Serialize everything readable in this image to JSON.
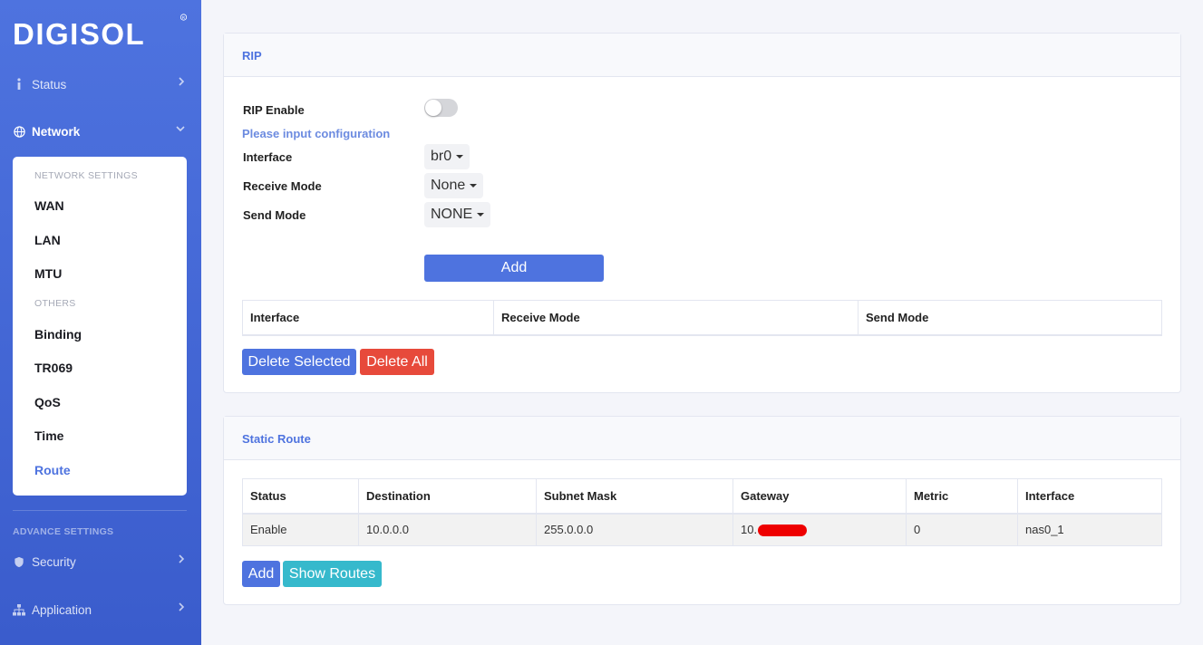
{
  "brand": {
    "logo_text": "DIGISOL"
  },
  "sidebar": {
    "status_label": "Status",
    "network_label": "Network",
    "network_settings_heading": "NETWORK SETTINGS",
    "network_items": [
      "WAN",
      "LAN",
      "MTU"
    ],
    "others_heading": "OTHERS",
    "others_items": [
      "Binding",
      "TR069",
      "QoS",
      "Time",
      "Route"
    ],
    "advance_heading": "ADVANCE SETTINGS",
    "security_label": "Security",
    "application_label": "Application"
  },
  "rip": {
    "title": "RIP",
    "enable_label": "RIP Enable",
    "enabled": false,
    "hint": "Please input configuration",
    "interface_label": "Interface",
    "interface_value": "br0",
    "receive_mode_label": "Receive Mode",
    "receive_mode_value": "None",
    "send_mode_label": "Send Mode",
    "send_mode_value": "NONE",
    "add_button": "Add",
    "table_headers": [
      "Interface",
      "Receive Mode",
      "Send Mode"
    ],
    "delete_selected_button": "Delete Selected",
    "delete_all_button": "Delete All"
  },
  "static_route": {
    "title": "Static Route",
    "table_headers": [
      "Status",
      "Destination",
      "Subnet Mask",
      "Gateway",
      "Metric",
      "Interface"
    ],
    "rows": [
      {
        "status": "Enable",
        "destination": "10.0.0.0",
        "subnet_mask": "255.0.0.0",
        "gateway_prefix": "10.",
        "metric": "0",
        "interface": "nas0_1"
      }
    ],
    "add_button": "Add",
    "show_routes_button": "Show Routes"
  },
  "colors": {
    "primary": "#4e73df",
    "danger": "#e74a3b",
    "info": "#36b9cc"
  }
}
